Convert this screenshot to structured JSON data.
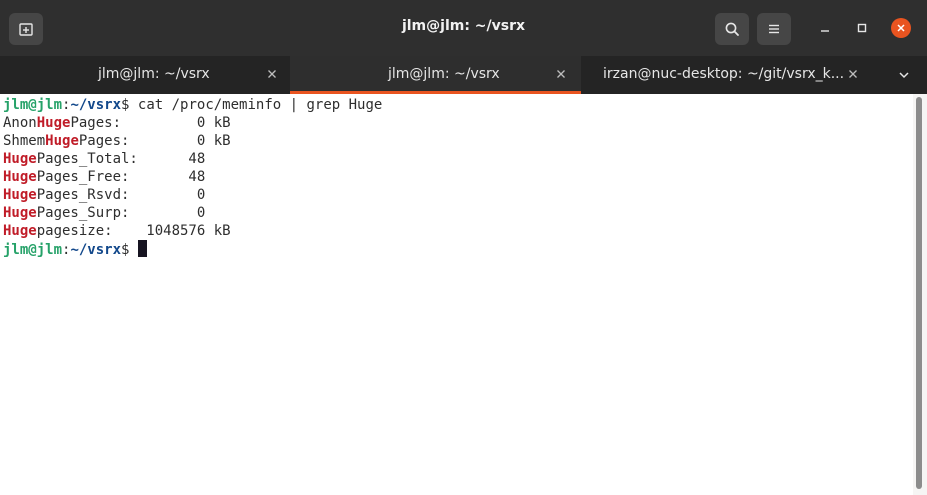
{
  "window": {
    "title": "jlm@jlm: ~/vsrx",
    "icons": {
      "new_tab": "new-tab-icon",
      "search": "search-icon",
      "menu": "hamburger-menu-icon",
      "minimize": "minimize-icon",
      "maximize": "maximize-icon",
      "close": "close-icon"
    },
    "accent_color": "#e95420"
  },
  "tabs": [
    {
      "label": "jlm@jlm: ~/vsrx",
      "active": false
    },
    {
      "label": "jlm@jlm: ~/vsrx",
      "active": true
    },
    {
      "label": "irzan@nuc-desktop: ~/git/vsrx_k...",
      "active": false
    }
  ],
  "terminal": {
    "colors": {
      "user": "#26a269",
      "path": "#12488b",
      "match": "#c01c28",
      "text": "#2e2e2e"
    },
    "prompt": {
      "user_host": "jlm@jlm",
      "separator": ":",
      "path": "~/vsrx",
      "symbol": "$"
    },
    "command": " cat /proc/meminfo | grep Huge",
    "lines": [
      {
        "pre": "Anon",
        "match": "Huge",
        "post": "Pages:         0 kB"
      },
      {
        "pre": "Shmem",
        "match": "Huge",
        "post": "Pages:        0 kB"
      },
      {
        "pre": "",
        "match": "Huge",
        "post": "Pages_Total:      48"
      },
      {
        "pre": "",
        "match": "Huge",
        "post": "Pages_Free:       48"
      },
      {
        "pre": "",
        "match": "Huge",
        "post": "Pages_Rsvd:        0"
      },
      {
        "pre": "",
        "match": "Huge",
        "post": "Pages_Surp:        0"
      },
      {
        "pre": "",
        "match": "Huge",
        "post": "pagesize:    1048576 kB"
      }
    ],
    "prompt2": {
      "user_host": "jlm@jlm",
      "separator": ":",
      "path": "~/vsrx",
      "symbol": "$ "
    }
  }
}
